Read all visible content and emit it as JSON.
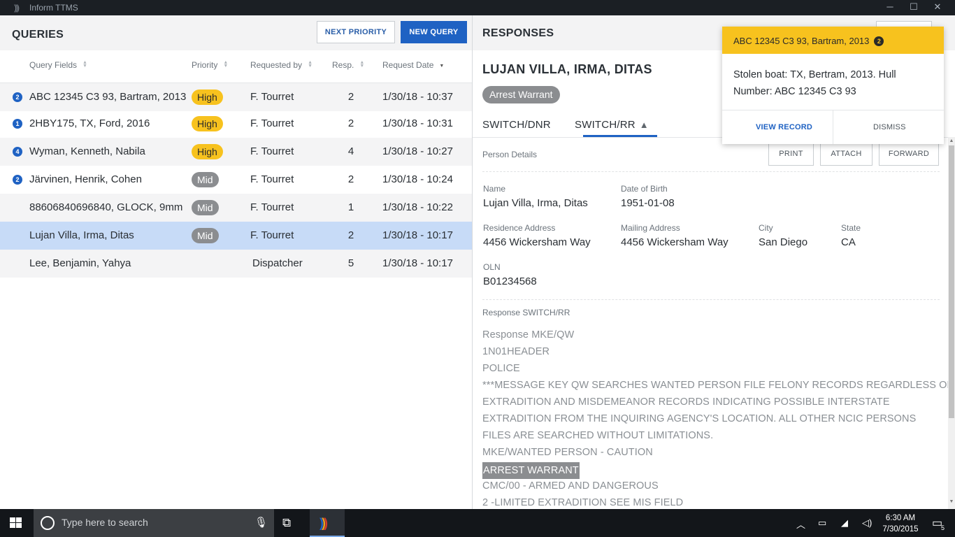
{
  "window": {
    "title": "Inform TTMS",
    "minimize": "─",
    "maximize": "☐",
    "close": "✕"
  },
  "queries": {
    "title": "QUERIES",
    "next_priority": "NEXT PRIORITY",
    "new_query": "NEW QUERY",
    "columns": [
      "Query Fields",
      "Priority",
      "Requested by",
      "Resp.",
      "Request Date"
    ],
    "rows": [
      {
        "badge": "2",
        "query": "ABC 12345 C3 93, Bartram, 2013",
        "priority": "High",
        "requested_by": "F. Tourret",
        "resp": "2",
        "date": "1/30/18 - 10:37"
      },
      {
        "badge": "1",
        "query": "2HBY175, TX, Ford, 2016",
        "priority": "High",
        "requested_by": "F. Tourret",
        "resp": "2",
        "date": "1/30/18 - 10:31"
      },
      {
        "badge": "4",
        "query": "Wyman, Kenneth, Nabila",
        "priority": "High",
        "requested_by": "F. Tourret",
        "resp": "4",
        "date": "1/30/18 - 10:27"
      },
      {
        "badge": "2",
        "query": "Järvinen, Henrik, Cohen",
        "priority": "Mid",
        "requested_by": "F. Tourret",
        "resp": "2",
        "date": "1/30/18 - 10:24"
      },
      {
        "badge": "",
        "query": "88606840696840, GLOCK, 9mm",
        "priority": "Mid",
        "requested_by": "F. Tourret",
        "resp": "1",
        "date": "1/30/18 - 10:22"
      },
      {
        "badge": "",
        "query": "Lujan Villa, Irma, Ditas",
        "priority": "Mid",
        "requested_by": "F. Tourret",
        "resp": "2",
        "date": "1/30/18 - 10:17"
      },
      {
        "badge": "",
        "query": "Lee, Benjamin, Yahya",
        "priority": "",
        "requested_by": "Dispatcher",
        "resp": "5",
        "date": "1/30/18 - 10:17"
      }
    ]
  },
  "responses": {
    "title": "RESPONSES",
    "person_name": "LUJAN VILLA, IRMA, DITAS",
    "badge": "Arrest Warrant",
    "tabs": [
      "SWITCH/DNR",
      "SWITCH/RR"
    ],
    "person_details_label": "Person Details",
    "actions": [
      "PRINT",
      "ATTACH",
      "FORWARD"
    ],
    "fields": {
      "name_label": "Name",
      "name": "Lujan Villa, Irma, Ditas",
      "dob_label": "Date of Birth",
      "dob": "1951-01-08",
      "residence_label": "Residence Address",
      "residence": "4456 Wickersham Way",
      "mailing_label": "Mailing Address",
      "mailing": "4456 Wickersham Way",
      "city_label": "City",
      "city": "San Diego",
      "state_label": "State",
      "state": "CA",
      "oln_label": "OLN",
      "oln": "B01234568"
    },
    "response_label": "Response SWITCH/RR",
    "response_lines": [
      "Response MKE/QW",
      "1N01HEADER",
      "POLICE",
      "***MESSAGE KEY QW SEARCHES WANTED PERSON FILE FELONY RECORDS REGARDLESS OF",
      "EXTRADITION AND MISDEMEANOR RECORDS INDICATING POSSIBLE INTERSTATE",
      "EXTRADITION FROM THE INQUIRING AGENCY'S LOCATION. ALL OTHER NCIC PERSONS",
      "FILES ARE SEARCHED WITHOUT LIMITATIONS.",
      "MKE/WANTED PERSON - CAUTION",
      "ARREST WARRANT",
      "CMC/00 - ARMED AND DANGEROUS",
      "2 -LIMITED EXTRADITION SEE MIS FIELD"
    ]
  },
  "notification": {
    "title": "ABC 12345 C3 93, Bartram, 2013",
    "count": "2",
    "body": "Stolen boat: TX, Bertram, 2013. Hull Number: ABC 12345 C3 93",
    "view_record": "VIEW RECORD",
    "dismiss": "DISMISS"
  },
  "taskbar": {
    "search_placeholder": "Type here to search",
    "time": "6:30 AM",
    "date": "7/30/2015",
    "notification_count": "5"
  },
  "colors": {
    "accent": "#1f62c3",
    "high": "#f7c21e",
    "mid": "#8b8d90",
    "selected_row": "#c7dbf7"
  }
}
